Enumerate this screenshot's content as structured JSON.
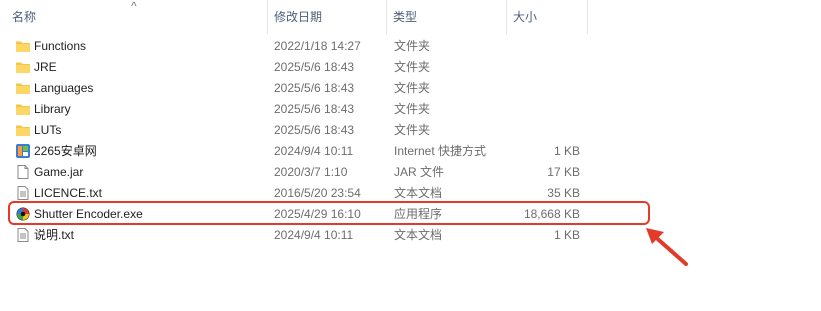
{
  "columns": {
    "name": "名称",
    "date": "修改日期",
    "type": "类型",
    "size": "大小"
  },
  "rows": [
    {
      "name": "Functions",
      "date": "2022/1/18 14:27",
      "type": "文件夹",
      "size": "",
      "icon": "folder-icon"
    },
    {
      "name": "JRE",
      "date": "2025/5/6 18:43",
      "type": "文件夹",
      "size": "",
      "icon": "folder-icon"
    },
    {
      "name": "Languages",
      "date": "2025/5/6 18:43",
      "type": "文件夹",
      "size": "",
      "icon": "folder-icon"
    },
    {
      "name": "Library",
      "date": "2025/5/6 18:43",
      "type": "文件夹",
      "size": "",
      "icon": "folder-icon"
    },
    {
      "name": "LUTs",
      "date": "2025/5/6 18:43",
      "type": "文件夹",
      "size": "",
      "icon": "folder-icon"
    },
    {
      "name": "2265安卓网",
      "date": "2024/9/4 10:11",
      "type": "Internet 快捷方式",
      "size": "1 KB",
      "icon": "internet-shortcut-icon"
    },
    {
      "name": "Game.jar",
      "date": "2020/3/7 1:10",
      "type": "JAR 文件",
      "size": "17 KB",
      "icon": "file-icon"
    },
    {
      "name": "LICENCE.txt",
      "date": "2016/5/20 23:54",
      "type": "文本文档",
      "size": "35 KB",
      "icon": "text-file-icon"
    },
    {
      "name": "Shutter Encoder.exe",
      "date": "2025/4/29 16:10",
      "type": "应用程序",
      "size": "18,668 KB",
      "icon": "shutter-encoder-app-icon"
    },
    {
      "name": "说明.txt",
      "date": "2024/9/4 10:11",
      "type": "文本文档",
      "size": "1 KB",
      "icon": "text-file-icon"
    }
  ],
  "colors": {
    "highlight": "#e23b2a",
    "folder": "#f5c54a",
    "header_text": "#4c607a"
  }
}
